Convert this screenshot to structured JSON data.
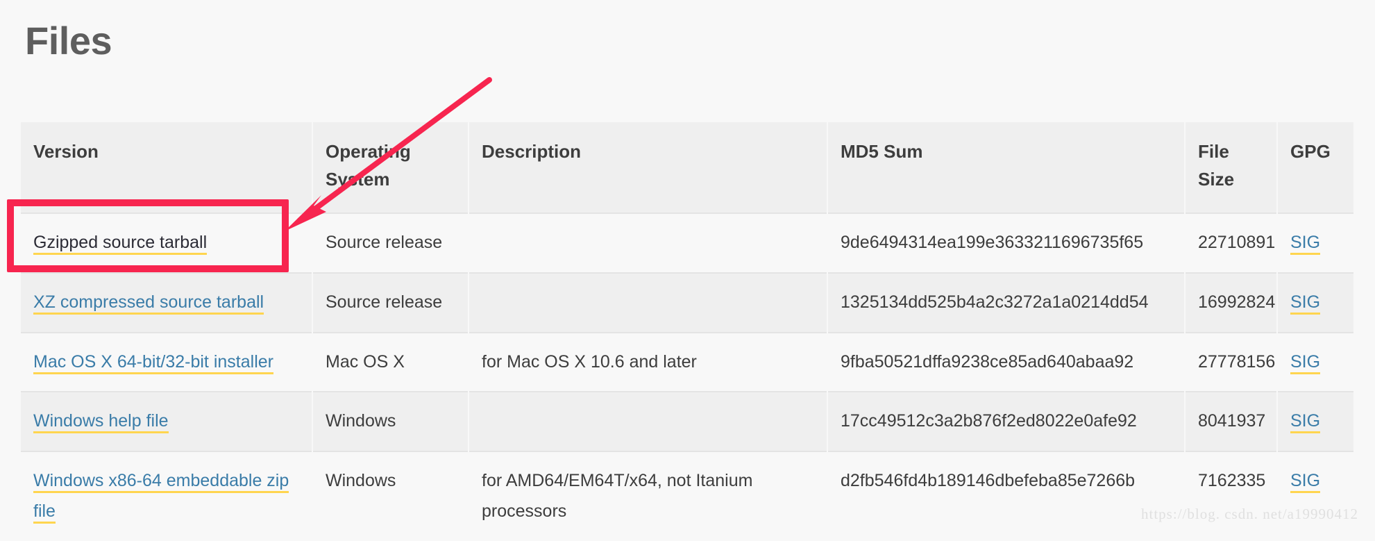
{
  "page": {
    "title": "Files"
  },
  "table": {
    "headers": [
      "Version",
      "Operating System",
      "Description",
      "MD5 Sum",
      "File Size",
      "GPG"
    ],
    "rows": [
      {
        "version": "Gzipped source tarball",
        "version_state": "visited",
        "os": "Source release",
        "description": "",
        "md5": "9de6494314ea199e3633211696735f65",
        "size": "22710891",
        "gpg": "SIG"
      },
      {
        "version": "XZ compressed source tarball",
        "version_state": "link",
        "os": "Source release",
        "description": "",
        "md5": "1325134dd525b4a2c3272a1a0214dd54",
        "size": "16992824",
        "gpg": "SIG"
      },
      {
        "version": "Mac OS X 64-bit/32-bit installer",
        "version_state": "link",
        "os": "Mac OS X",
        "description": "for Mac OS X 10.6 and later",
        "md5": "9fba50521dffa9238ce85ad640abaa92",
        "size": "27778156",
        "gpg": "SIG"
      },
      {
        "version": "Windows help file",
        "version_state": "link",
        "os": "Windows",
        "description": "",
        "md5": "17cc49512c3a2b876f2ed8022e0afe92",
        "size": "8041937",
        "gpg": "SIG"
      },
      {
        "version": "Windows x86-64 embeddable zip file",
        "version_state": "link",
        "os": "Windows",
        "description": "for AMD64/EM64T/x64, not Itanium processors",
        "md5": "d2fb546fd4b189146dbefeba85e7266b",
        "size": "7162335",
        "gpg": "SIG"
      }
    ]
  },
  "annotation": {
    "highlight_target": "Gzipped source tarball",
    "color": "#f7254f",
    "arrow_from": "705,115",
    "arrow_to": "412,333"
  },
  "watermark": {
    "text": "https://blog. csdn. net/a19990412"
  },
  "colors": {
    "link": "#3a7ca8",
    "link_underline": "#ffd54f",
    "header_bg": "#efefef",
    "row_odd_bg": "#f8f8f8",
    "row_even_bg": "#efefef",
    "heading": "#5e5e5e",
    "annotation_red": "#f7254f"
  }
}
